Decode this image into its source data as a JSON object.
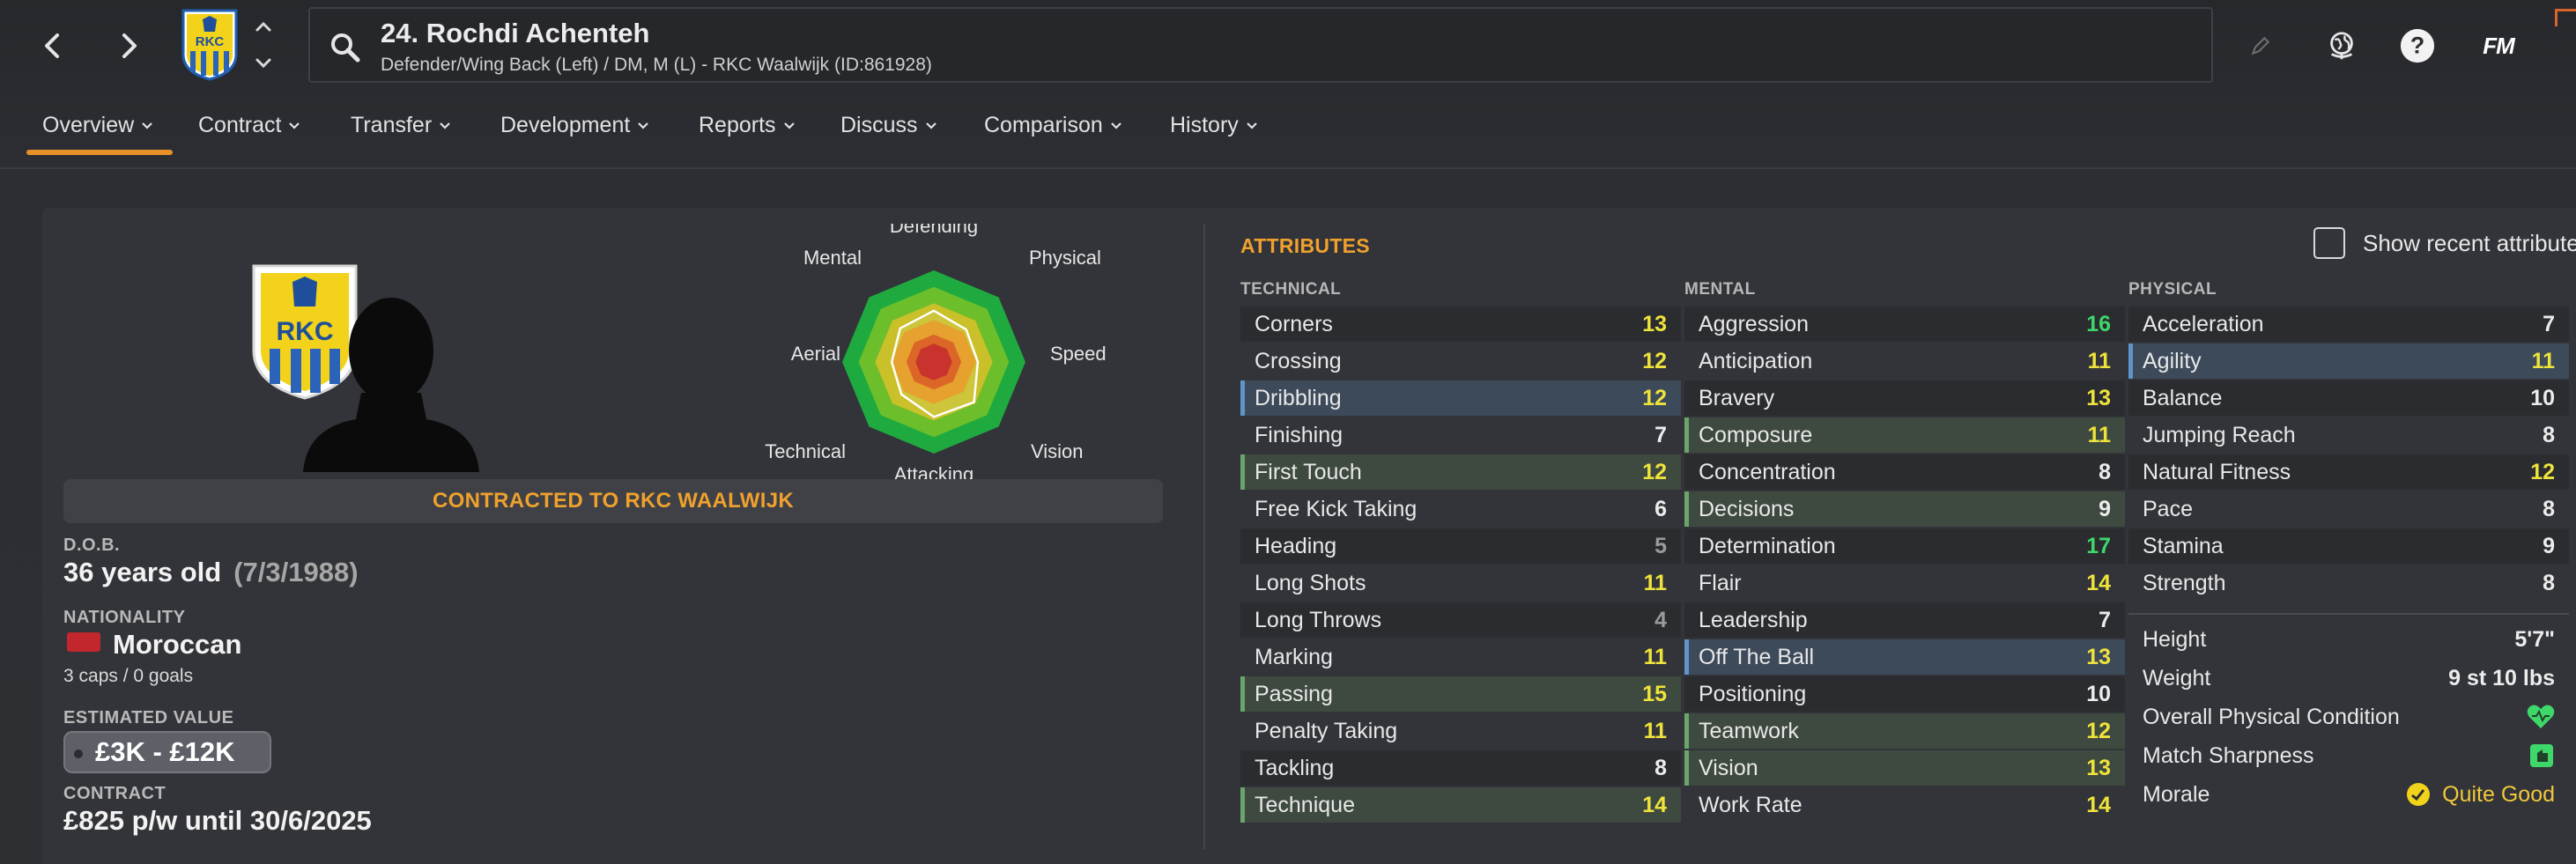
{
  "header": {
    "player_name": "24. Rochdi Achenteh",
    "player_sub": "Defender/Wing Back (Left) / DM, M (L) - RKC Waalwijk (ID:861928)",
    "fm_logo": "FM",
    "icons": [
      "back-arrow-icon",
      "forward-arrow-icon",
      "club-badge-icon",
      "up-down-icon",
      "search-icon",
      "pencil-icon",
      "globe-icon",
      "help-icon"
    ]
  },
  "tabs": [
    {
      "label": "Overview"
    },
    {
      "label": "Contract"
    },
    {
      "label": "Transfer"
    },
    {
      "label": "Development"
    },
    {
      "label": "Reports"
    },
    {
      "label": "Discuss"
    },
    {
      "label": "Comparison"
    },
    {
      "label": "History"
    }
  ],
  "radar": {
    "labels": [
      "Defending",
      "Physical",
      "Speed",
      "Vision",
      "Attacking",
      "Technical",
      "Aerial",
      "Mental"
    ],
    "ring_colors": [
      "#1faa3f",
      "#6cbf2a",
      "#c9c02a",
      "#e49a1e",
      "#d85a16",
      "#c4231c"
    ]
  },
  "club_badge_text": "RKC",
  "contract_banner": "CONTRACTED TO RKC WAALWIJK",
  "info": {
    "dob_label": "D.O.B.",
    "age": "36 years old",
    "dob": "(7/3/1988)",
    "nationality_label": "NATIONALITY",
    "nationality": "Moroccan",
    "flag_color": "#c1272d",
    "caps": "3 caps / 0 goals",
    "value_label": "ESTIMATED VALUE",
    "value": "£3K - £12K",
    "contract_label": "CONTRACT",
    "contract": "£825 p/w until 30/6/2025"
  },
  "attributes": {
    "title": "ATTRIBUTES",
    "show_recent": "Show recent attributes",
    "technical_label": "TECHNICAL",
    "mental_label": "MENTAL",
    "physical_label": "PHYSICAL",
    "technical": [
      {
        "name": "Corners",
        "value": "13",
        "color": "yellow",
        "hl": ""
      },
      {
        "name": "Crossing",
        "value": "12",
        "color": "yellow",
        "hl": ""
      },
      {
        "name": "Dribbling",
        "value": "12",
        "color": "yellow",
        "hl": "blue"
      },
      {
        "name": "Finishing",
        "value": "7",
        "color": "white",
        "hl": ""
      },
      {
        "name": "First Touch",
        "value": "12",
        "color": "yellow",
        "hl": "green"
      },
      {
        "name": "Free Kick Taking",
        "value": "6",
        "color": "white",
        "hl": ""
      },
      {
        "name": "Heading",
        "value": "5",
        "color": "grey",
        "hl": ""
      },
      {
        "name": "Long Shots",
        "value": "11",
        "color": "yellow",
        "hl": ""
      },
      {
        "name": "Long Throws",
        "value": "4",
        "color": "grey",
        "hl": ""
      },
      {
        "name": "Marking",
        "value": "11",
        "color": "yellow",
        "hl": ""
      },
      {
        "name": "Passing",
        "value": "15",
        "color": "yellow",
        "hl": "green"
      },
      {
        "name": "Penalty Taking",
        "value": "11",
        "color": "yellow",
        "hl": ""
      },
      {
        "name": "Tackling",
        "value": "8",
        "color": "white",
        "hl": ""
      },
      {
        "name": "Technique",
        "value": "14",
        "color": "yellow",
        "hl": "green"
      }
    ],
    "mental": [
      {
        "name": "Aggression",
        "value": "16",
        "color": "green",
        "hl": ""
      },
      {
        "name": "Anticipation",
        "value": "11",
        "color": "yellow",
        "hl": ""
      },
      {
        "name": "Bravery",
        "value": "13",
        "color": "yellow",
        "hl": ""
      },
      {
        "name": "Composure",
        "value": "11",
        "color": "yellow",
        "hl": "green"
      },
      {
        "name": "Concentration",
        "value": "8",
        "color": "white",
        "hl": ""
      },
      {
        "name": "Decisions",
        "value": "9",
        "color": "white",
        "hl": "green"
      },
      {
        "name": "Determination",
        "value": "17",
        "color": "green",
        "hl": ""
      },
      {
        "name": "Flair",
        "value": "14",
        "color": "yellow",
        "hl": ""
      },
      {
        "name": "Leadership",
        "value": "7",
        "color": "white",
        "hl": ""
      },
      {
        "name": "Off The Ball",
        "value": "13",
        "color": "yellow",
        "hl": "blue"
      },
      {
        "name": "Positioning",
        "value": "10",
        "color": "white",
        "hl": ""
      },
      {
        "name": "Teamwork",
        "value": "12",
        "color": "yellow",
        "hl": "green"
      },
      {
        "name": "Vision",
        "value": "13",
        "color": "yellow",
        "hl": "green"
      },
      {
        "name": "Work Rate",
        "value": "14",
        "color": "yellow",
        "hl": ""
      }
    ],
    "physical": [
      {
        "name": "Acceleration",
        "value": "7",
        "color": "white",
        "hl": ""
      },
      {
        "name": "Agility",
        "value": "11",
        "color": "yellow",
        "hl": "blue"
      },
      {
        "name": "Balance",
        "value": "10",
        "color": "white",
        "hl": ""
      },
      {
        "name": "Jumping Reach",
        "value": "8",
        "color": "white",
        "hl": ""
      },
      {
        "name": "Natural Fitness",
        "value": "12",
        "color": "yellow",
        "hl": ""
      },
      {
        "name": "Pace",
        "value": "8",
        "color": "white",
        "hl": ""
      },
      {
        "name": "Stamina",
        "value": "9",
        "color": "white",
        "hl": ""
      },
      {
        "name": "Strength",
        "value": "8",
        "color": "white",
        "hl": ""
      }
    ],
    "physical_info": [
      {
        "name": "Height",
        "value": "5'7\""
      },
      {
        "name": "Weight",
        "value": "9 st 10 lbs"
      },
      {
        "name": "Overall Physical Condition",
        "icon": "heart-icon"
      },
      {
        "name": "Match Sharpness",
        "icon": "sharpness-icon"
      },
      {
        "name": "Morale",
        "value": "Quite Good",
        "icon": "morale-icon"
      }
    ]
  }
}
